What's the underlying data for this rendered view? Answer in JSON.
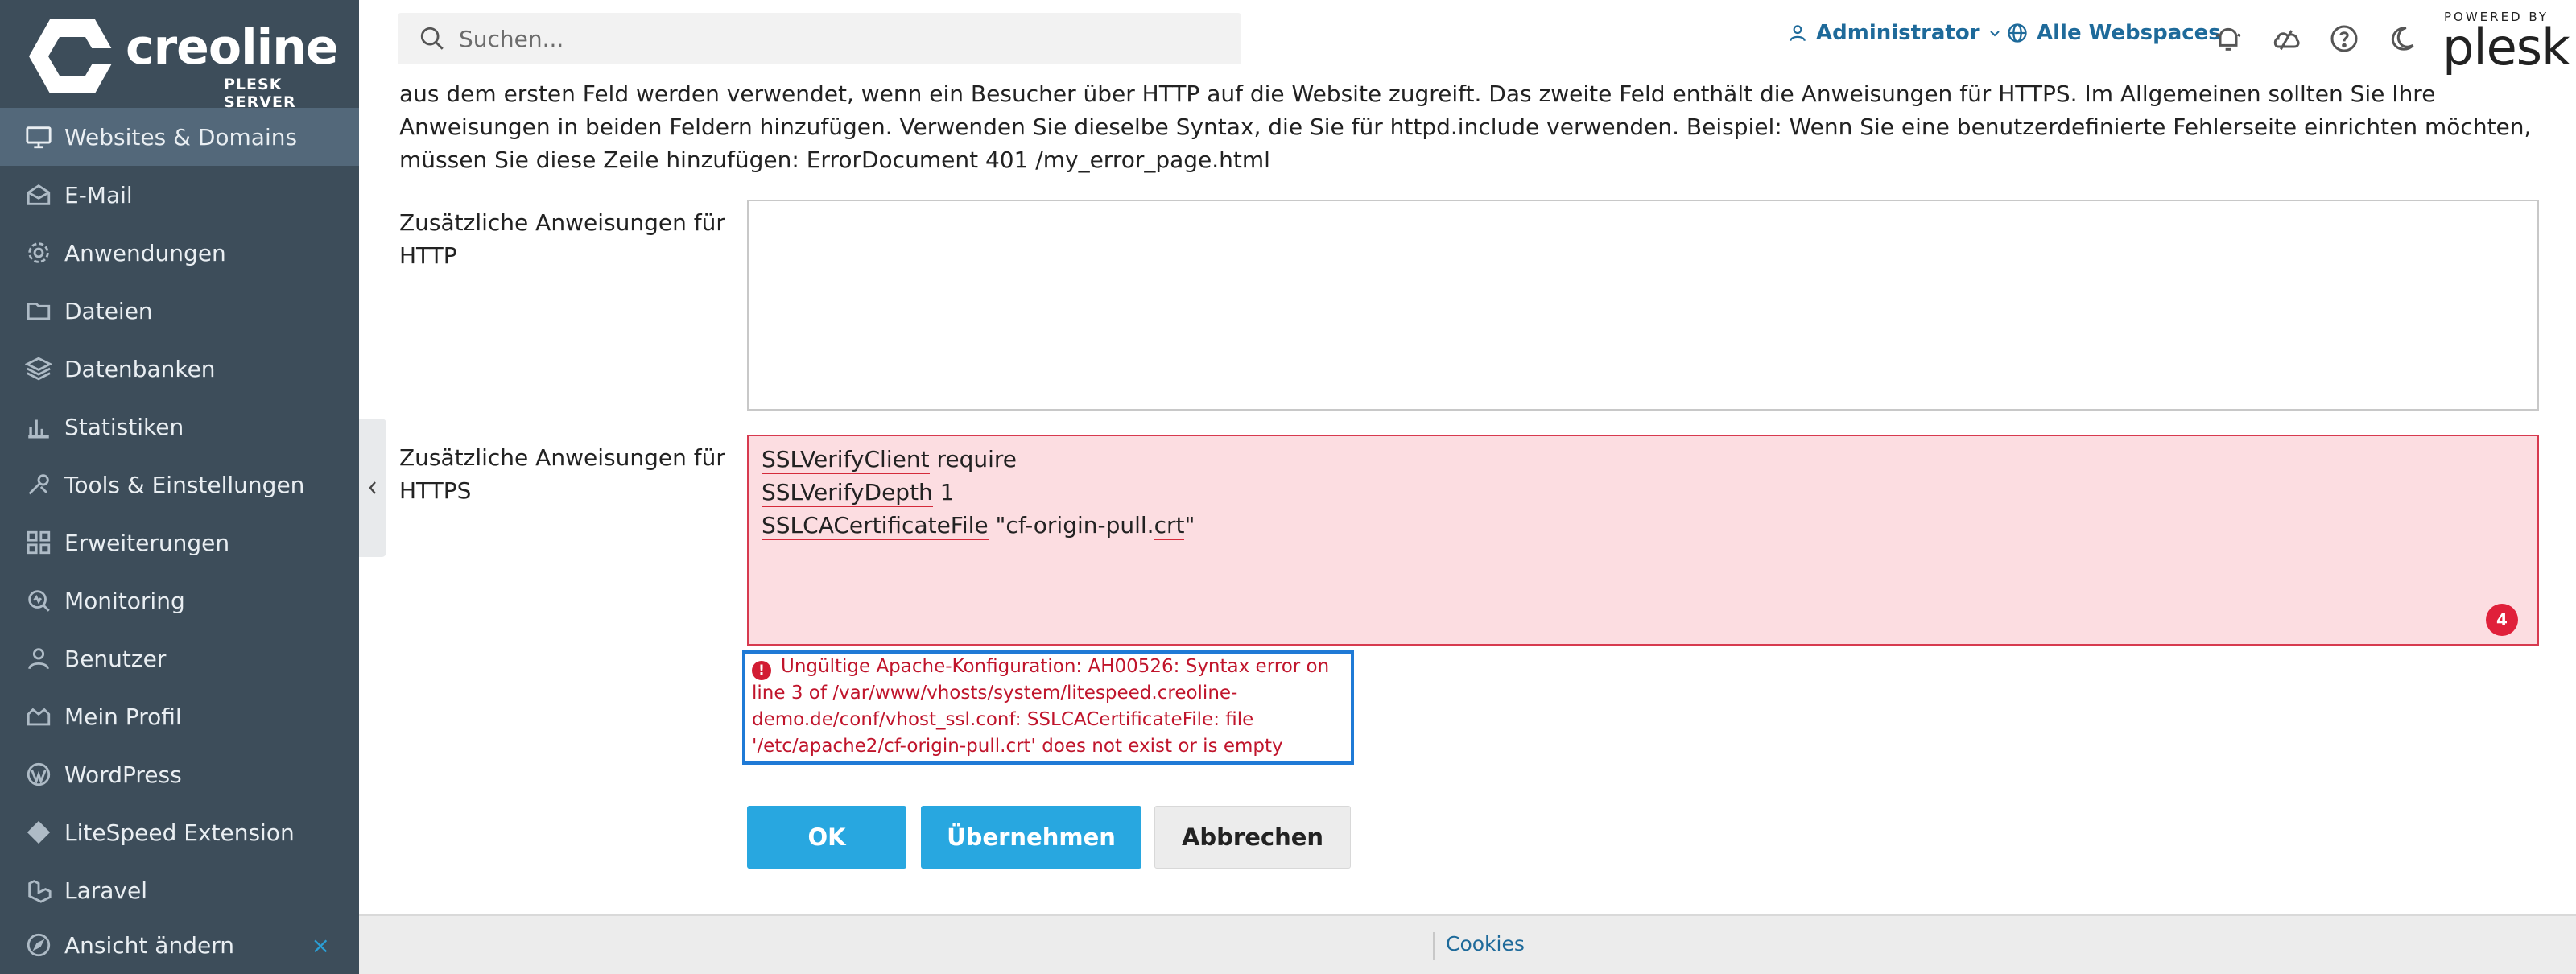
{
  "brand": {
    "name": "creoline",
    "subtitle": "PLESK SERVER"
  },
  "sidebar": {
    "items": [
      {
        "label": "Websites & Domains",
        "icon": "monitor-icon",
        "active": true
      },
      {
        "label": "E-Mail",
        "icon": "mail-icon"
      },
      {
        "label": "Anwendungen",
        "icon": "gear-icon"
      },
      {
        "label": "Dateien",
        "icon": "folder-icon"
      },
      {
        "label": "Datenbanken",
        "icon": "layers-icon"
      },
      {
        "label": "Statistiken",
        "icon": "bar-chart-icon"
      },
      {
        "label": "Tools & Einstellungen",
        "icon": "tools-icon"
      },
      {
        "label": "Erweiterungen",
        "icon": "extensions-icon"
      },
      {
        "label": "Monitoring",
        "icon": "monitoring-icon"
      },
      {
        "label": "Benutzer",
        "icon": "user-icon"
      },
      {
        "label": "Mein Profil",
        "icon": "profile-icon"
      },
      {
        "label": "WordPress",
        "icon": "wordpress-icon"
      },
      {
        "label": "LiteSpeed Extension",
        "icon": "litespeed-icon"
      },
      {
        "label": "Laravel",
        "icon": "laravel-icon"
      }
    ],
    "bottom": {
      "label": "Ansicht ändern",
      "close": "×"
    }
  },
  "header": {
    "search_placeholder": "Suchen...",
    "user": "Administrator",
    "webspaces": "Alle Webspaces",
    "powered_by": "POWERED BY",
    "plesk": "plesk"
  },
  "main": {
    "intro": "aus dem ersten Feld werden verwendet, wenn ein Besucher über HTTP auf die Website zugreift. Das zweite Feld enthält die Anweisungen für HTTPS. Im Allgemeinen sollten Sie Ihre Anweisungen in beiden Feldern hinzufügen. Verwenden Sie dieselbe Syntax, die Sie für httpd.include verwenden. Beispiel: Wenn Sie eine benutzerdefinierte Fehlerseite einrichten möchten, müssen Sie diese Zeile hinzufügen: ErrorDocument 401 /my_error_page.html",
    "http_label": "Zusätzliche Anweisungen für HTTP",
    "http_value": "",
    "https_label": "Zusätzliche Anweisungen für HTTPS",
    "https_lines": [
      {
        "word": "SSLVerifyClient",
        "rest": " require"
      },
      {
        "word": "SSLVerifyDepth",
        "rest": " 1"
      },
      {
        "word": "SSLCACertificateFile",
        "rest": " \"cf-origin-pull.",
        "word2": "crt",
        "rest2": "\""
      }
    ],
    "error_count": "4",
    "error_icon": "!",
    "error_message": "Ungültige Apache-Konfiguration: AH00526: Syntax error on line 3 of /var/www/vhosts/system/litespeed.creoline-demo.de/conf/vhost_ssl.conf: SSLCACertificateFile: file '/etc/apache2/cf-origin-pull.crt' does not exist or is empty",
    "buttons": {
      "ok": "OK",
      "apply": "Übernehmen",
      "cancel": "Abbrechen"
    }
  },
  "footer": {
    "cookies": "Cookies"
  },
  "colors": {
    "sidebar": "#3d4d5a",
    "sidebar_active": "#53687a",
    "primary": "#28a7e0",
    "error": "#c0142b",
    "link": "#1e6a9a"
  }
}
